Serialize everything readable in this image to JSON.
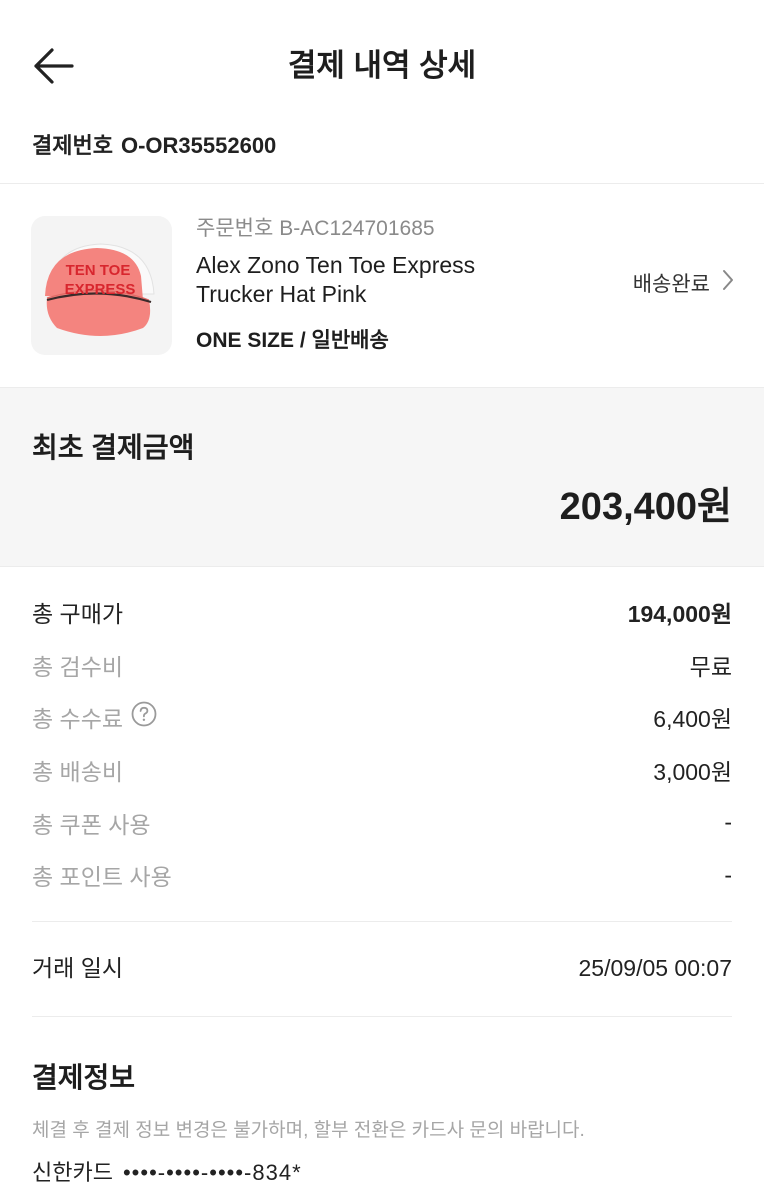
{
  "header": {
    "title": "결제 내역 상세",
    "back_icon": "arrow-left-icon"
  },
  "payment_number": {
    "label": "결제번호",
    "value": "O-OR35552600"
  },
  "order": {
    "order_no_label": "주문번호",
    "order_no": "B-AC124701685",
    "product_name": "Alex Zono Ten Toe Express Trucker Hat Pink",
    "option": "ONE SIZE / 일반배송",
    "status": "배송완료",
    "status_icon": "chevron-right-icon",
    "image_text_line1": "TEN TOE",
    "image_text_line2": "EXPRESS"
  },
  "initial_payment": {
    "label": "최초 결제금액",
    "amount": "203,400원"
  },
  "breakdown": [
    {
      "label": "총 구매가",
      "value": "194,000원"
    },
    {
      "label": "총 검수비",
      "value": "무료"
    },
    {
      "label": "총 수수료",
      "value": "6,400원",
      "icon": "question-circle-icon"
    },
    {
      "label": "총 배송비",
      "value": "3,000원"
    },
    {
      "label": "총 쿠폰 사용",
      "value": "-"
    },
    {
      "label": "총 포인트 사용",
      "value": "-"
    }
  ],
  "transaction": {
    "label": "거래 일시",
    "value": "25/09/05 00:07"
  },
  "payment_info": {
    "title": "결제정보",
    "notice": "체결 후 결제 정보 변경은 불가하며, 할부 전환은 카드사 문의 바랍니다.",
    "card_name": "신한카드",
    "card_number": "••••-••••-••••-834*"
  },
  "colors": {
    "hat_pink": "#f4847f",
    "hat_text_red": "#d8262e",
    "muted_text": "#a6a6a6",
    "panel_bg": "#f6f6f6"
  }
}
